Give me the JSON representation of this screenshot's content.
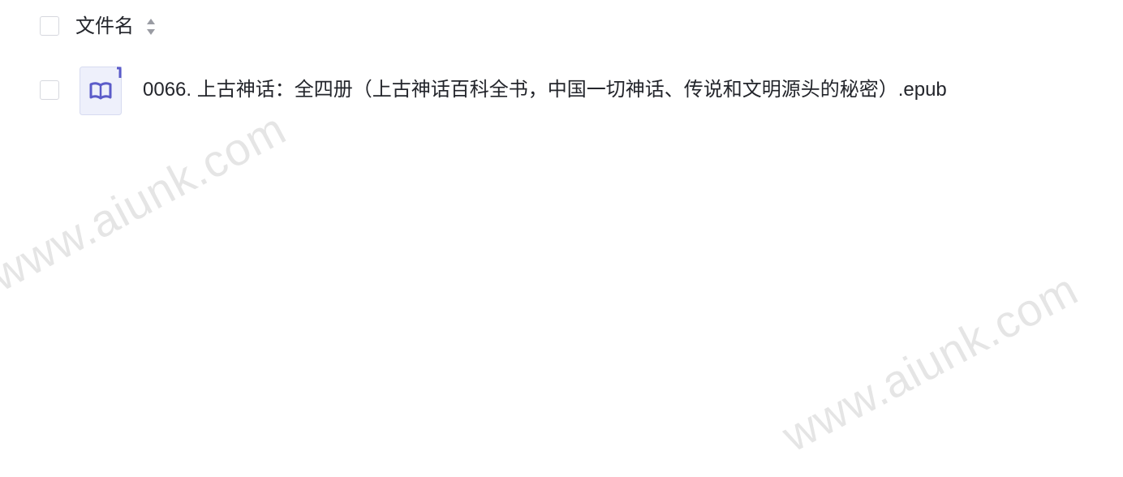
{
  "file_list": {
    "header": {
      "column_label": "文件名",
      "sort_icon": "sort-updown-icon"
    },
    "files": [
      {
        "name": "0066. 上古神话：全四册（上古神话百科全书，中国一切神话、传说和文明源头的秘密）.epub",
        "icon": "epub-book-icon"
      }
    ]
  },
  "watermark": {
    "text_1": "www.aiunk.com",
    "text_2": "www.aiunk.com"
  },
  "colors": {
    "text": "#23252b",
    "checkbox_border": "#d6d8de",
    "epub_icon_accent": "#5b5bc9",
    "epub_icon_bg": "#eef0fb"
  }
}
